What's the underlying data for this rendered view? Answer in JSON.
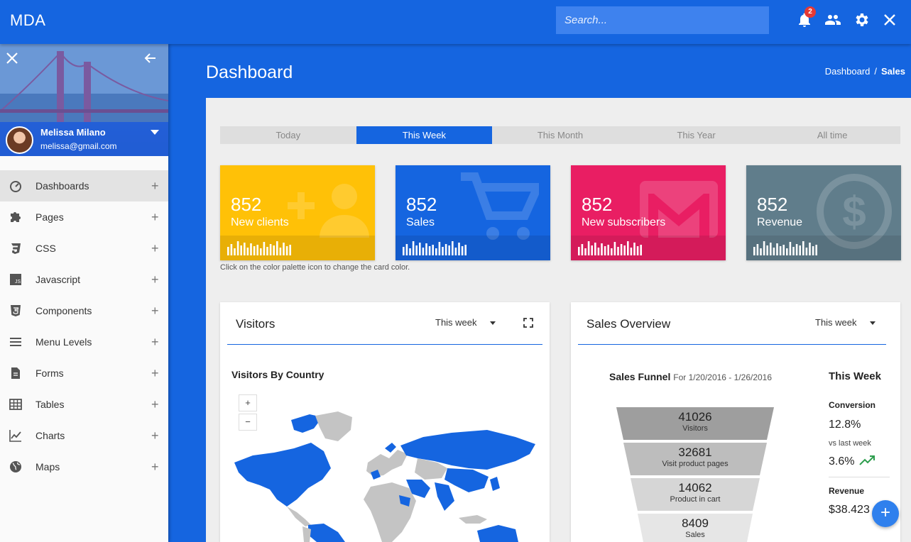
{
  "app": {
    "brand": "MDA"
  },
  "topbar": {
    "search_placeholder": "Search...",
    "notifications_count": "2",
    "icons": [
      "bell-icon",
      "people-icon",
      "gear-icon",
      "close-icon"
    ]
  },
  "sidebar": {
    "profile": {
      "name": "Melissa Milano",
      "email": "melissa@gmail.com"
    },
    "items": [
      {
        "label": "Dashboards",
        "icon": "gauge-icon",
        "expand": "+"
      },
      {
        "label": "Pages",
        "icon": "puzzle-icon",
        "expand": "+"
      },
      {
        "label": "CSS",
        "icon": "css3-icon",
        "expand": "+"
      },
      {
        "label": "Javascript",
        "icon": "js-icon",
        "expand": "+"
      },
      {
        "label": "Components",
        "icon": "html5-icon",
        "expand": "+"
      },
      {
        "label": "Menu Levels",
        "icon": "menu-icon",
        "expand": "+"
      },
      {
        "label": "Forms",
        "icon": "document-icon",
        "expand": "+"
      },
      {
        "label": "Tables",
        "icon": "table-icon",
        "expand": "+"
      },
      {
        "label": "Charts",
        "icon": "line-chart-icon",
        "expand": "+"
      },
      {
        "label": "Maps",
        "icon": "globe-icon",
        "expand": "+"
      }
    ]
  },
  "page": {
    "title": "Dashboard",
    "breadcrumb": {
      "home": "Dashboard",
      "separator": "/",
      "current": "Sales"
    }
  },
  "tabs": [
    "Today",
    "This Week",
    "This Month",
    "This Year",
    "All time"
  ],
  "cards": [
    {
      "value": "852",
      "label": "New clients",
      "color": "#ffc107",
      "icon": "add-user-icon"
    },
    {
      "value": "852",
      "label": "Sales",
      "color": "#1565e0",
      "icon": "cart-icon"
    },
    {
      "value": "852",
      "label": "New subscribers",
      "color": "#e91e63",
      "icon": "mail-icon"
    },
    {
      "value": "852",
      "label": "Revenue",
      "color": "#607d8b",
      "icon": "dollar-icon"
    }
  ],
  "cards_hint": "Click on the color palette icon to change the card color.",
  "visitors": {
    "title": "Visitors",
    "period": "This week",
    "subtitle": "Visitors By Country",
    "zoom_in": "+",
    "zoom_out": "−"
  },
  "sales_overview": {
    "title": "Sales Overview",
    "period": "This week",
    "funnel_title": "Sales Funnel",
    "funnel_range": "For 1/20/2016 - 1/26/2016",
    "funnel": [
      {
        "value": "41026",
        "label": "Visitors"
      },
      {
        "value": "32681",
        "label": "Visit product pages"
      },
      {
        "value": "14062",
        "label": "Product in cart"
      },
      {
        "value": "8409",
        "label": "Sales"
      }
    ],
    "stats": {
      "heading": "This Week",
      "conversion_label": "Conversion",
      "conversion_value": "12.8%",
      "vs_label": "vs last week",
      "vs_value": "3.6%",
      "revenue_label": "Revenue",
      "revenue_value": "$38.423"
    }
  },
  "fab": "+"
}
